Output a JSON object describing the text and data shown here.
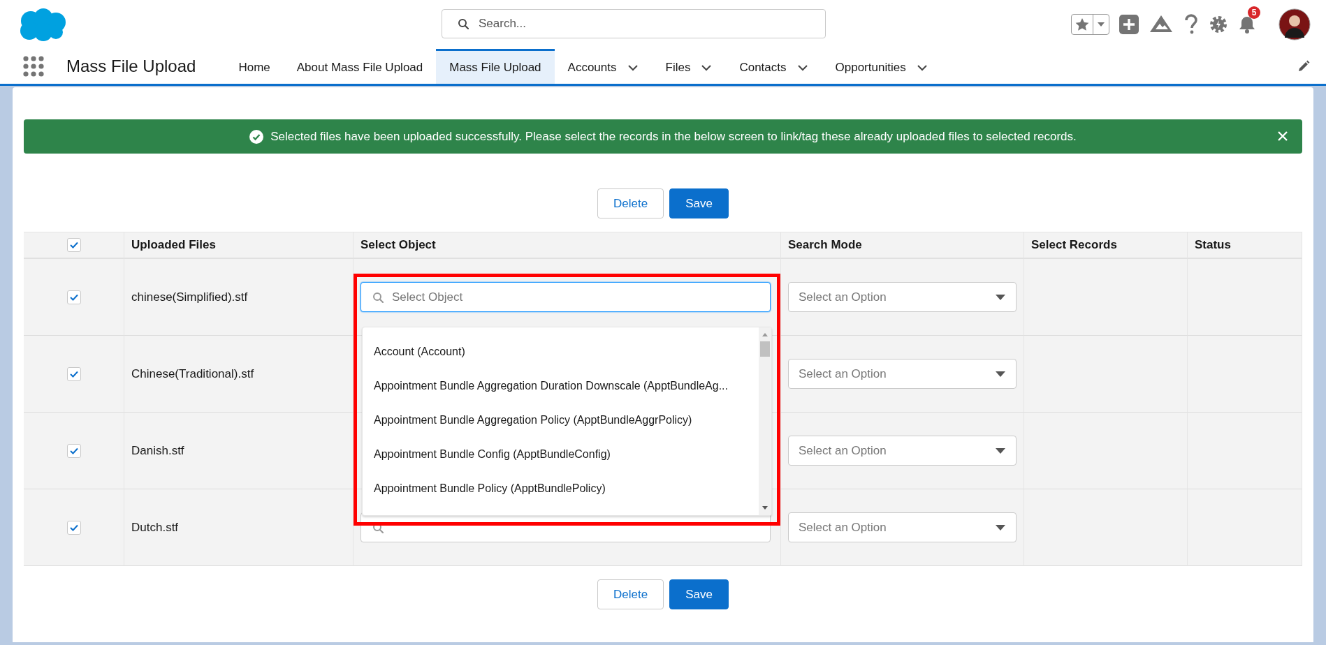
{
  "app": {
    "name": "Mass File Upload"
  },
  "search": {
    "placeholder": "Search..."
  },
  "notifications": {
    "count": "5"
  },
  "nav_tabs": [
    {
      "label": "Home",
      "selected": false,
      "dropdown": false
    },
    {
      "label": "About Mass File Upload",
      "selected": false,
      "dropdown": false
    },
    {
      "label": "Mass File Upload",
      "selected": true,
      "dropdown": false
    },
    {
      "label": "Accounts",
      "selected": false,
      "dropdown": true
    },
    {
      "label": "Files",
      "selected": false,
      "dropdown": true
    },
    {
      "label": "Contacts",
      "selected": false,
      "dropdown": true
    },
    {
      "label": "Opportunities",
      "selected": false,
      "dropdown": true
    }
  ],
  "banner": {
    "message": "Selected files have been uploaded successfully. Please select the records in the below screen to link/tag these already uploaded files to selected records."
  },
  "top_buttons": [
    {
      "label": "Delete",
      "kind": "neutral"
    },
    {
      "label": "Save",
      "kind": "brand"
    }
  ],
  "table": {
    "header_checked": true,
    "columns": [
      "Uploaded Files",
      "Select Object",
      "Search Mode",
      "Select Records",
      "Status"
    ],
    "rows": [
      {
        "checked": true,
        "file": "chinese(Simplified).stf",
        "select_object": {
          "placeholder": "Select Object",
          "focused": true
        },
        "search_mode": {
          "placeholder": "Select an Option"
        }
      },
      {
        "checked": true,
        "file": "Chinese(Traditional).stf",
        "search_mode": {
          "placeholder": "Select an Option"
        }
      },
      {
        "checked": true,
        "file": "Danish.stf",
        "search_mode": {
          "placeholder": "Select an Option"
        }
      },
      {
        "checked": true,
        "file": "Dutch.stf",
        "select_object": {
          "focused": false
        },
        "search_mode": {
          "placeholder": "Select an Option"
        }
      }
    ]
  },
  "object_dropdown": {
    "options": [
      "Account (Account)",
      "Appointment Bundle Aggregation Duration Downscale (ApptBundleAg...",
      "Appointment Bundle Aggregation Policy (ApptBundleAggrPolicy)",
      "Appointment Bundle Config (ApptBundleConfig)",
      "Appointment Bundle Policy (ApptBundlePolicy)"
    ]
  },
  "bottom_buttons": [
    {
      "label": "Delete",
      "kind": "neutral"
    },
    {
      "label": "Save",
      "kind": "brand"
    }
  ]
}
